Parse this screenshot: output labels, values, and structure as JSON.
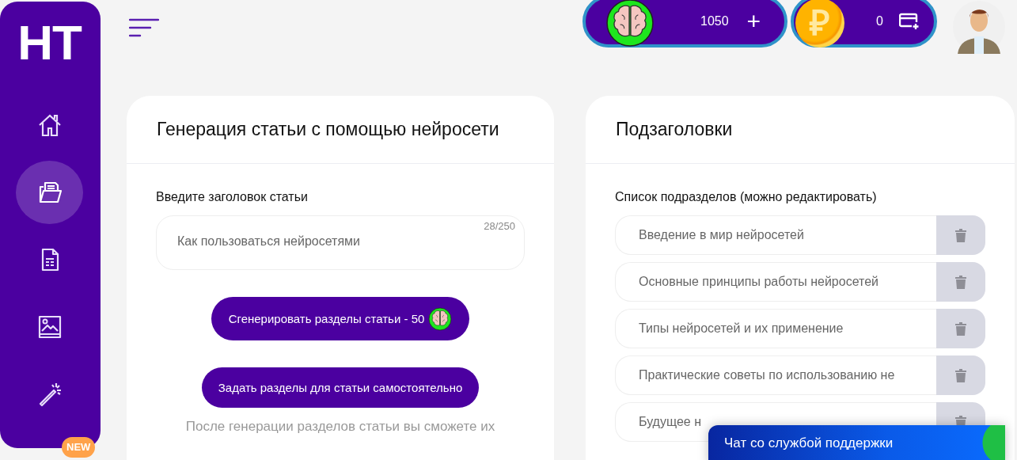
{
  "sidebar": {
    "logo": "HT",
    "nav_items": [
      {
        "kind": "home",
        "selected": false
      },
      {
        "kind": "folder",
        "selected": true
      },
      {
        "kind": "document",
        "selected": false
      },
      {
        "kind": "image",
        "selected": false
      },
      {
        "kind": "wand",
        "selected": false
      }
    ],
    "new_badge": "NEW"
  },
  "top_bar": {
    "neurons": {
      "balance": "1050",
      "add": "+"
    },
    "rubles": {
      "symbol": "₽",
      "balance": "0"
    }
  },
  "article_card": {
    "title": "Генерация статьи с помощью нейросети",
    "field_label": "Введите заголовок статьи",
    "title_field": {
      "value": "Как пользоваться нейросетями",
      "counter": "28/250"
    },
    "generate_button": {
      "label": "Сгенерировать разделы статьи - 50"
    },
    "manual_button": {
      "label": "Задать разделы для статьи самостоятельно"
    },
    "note": "После генерации разделов статьи вы сможете их"
  },
  "subheadings_card": {
    "title": "Подзаголовки",
    "list_label": "Список подразделов (можно редактировать)",
    "items": [
      {
        "value": "Введение в мир нейросетей"
      },
      {
        "value": "Основные принципы работы нейросетей"
      },
      {
        "value": "Типы нейросетей и их применение"
      },
      {
        "value": "Практические советы по использованию не"
      },
      {
        "value": "Будущее н"
      }
    ]
  },
  "support_chat": {
    "label": "Чат со службой поддержки"
  }
}
